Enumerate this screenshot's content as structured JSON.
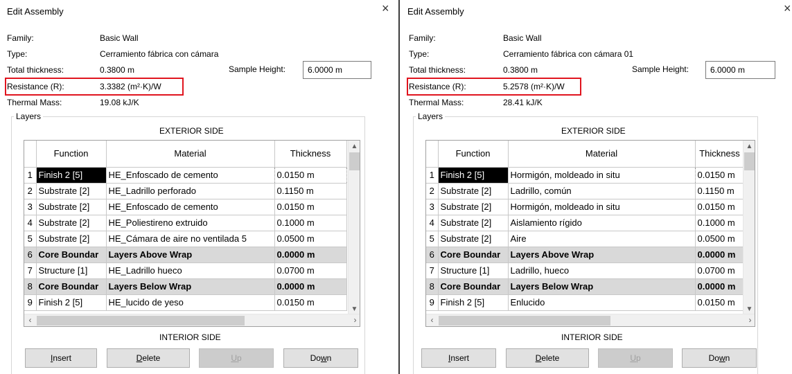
{
  "dialogs": [
    {
      "title": "Edit Assembly",
      "close_symbol": "×",
      "properties": {
        "family_label": "Family:",
        "family_value": "Basic Wall",
        "type_label": "Type:",
        "type_value": "Cerramiento fábrica con cámara",
        "thickness_label": "Total thickness:",
        "thickness_value": "0.3800 m",
        "resistance_label": "Resistance (R):",
        "resistance_value": "3.3382 (m²·K)/W",
        "mass_label": "Thermal Mass:",
        "mass_value": "19.08 kJ/K"
      },
      "sample_height_label": "Sample Height:",
      "sample_height_value": "6.0000 m",
      "layers_label": "Layers",
      "exterior_label": "EXTERIOR SIDE",
      "interior_label": "INTERIOR SIDE",
      "columns": [
        "Function",
        "Material",
        "Thickness"
      ],
      "rows": [
        {
          "num": "1",
          "function": "Finish 2 [5]",
          "material": "HE_Enfoscado de cemento",
          "thickness": "0.0150 m"
        },
        {
          "num": "2",
          "function": "Substrate [2]",
          "material": "HE_Ladrillo perforado",
          "thickness": "0.1150 m"
        },
        {
          "num": "3",
          "function": "Substrate [2]",
          "material": "HE_Enfoscado de cemento",
          "thickness": "0.0150 m"
        },
        {
          "num": "4",
          "function": "Substrate [2]",
          "material": "HE_Poliestireno extruido",
          "thickness": "0.1000 m"
        },
        {
          "num": "5",
          "function": "Substrate [2]",
          "material": "HE_Cámara de aire no ventilada 5",
          "thickness": "0.0500 m"
        },
        {
          "num": "6",
          "function": "Core Boundar",
          "material": "Layers Above Wrap",
          "thickness": "0.0000 m"
        },
        {
          "num": "7",
          "function": "Structure [1]",
          "material": "HE_Ladrillo hueco",
          "thickness": "0.0700 m"
        },
        {
          "num": "8",
          "function": "Core Boundar",
          "material": "Layers Below Wrap",
          "thickness": "0.0000 m"
        },
        {
          "num": "9",
          "function": "Finish 2 [5]",
          "material": "HE_lucido de yeso",
          "thickness": "0.0150 m"
        }
      ],
      "buttons": {
        "insert": {
          "text": "nsert",
          "ul": "I"
        },
        "delete": {
          "text": "elete",
          "ul": "D"
        },
        "up": {
          "text": "p",
          "ul": "U"
        },
        "down": {
          "pre": "Do",
          "ul": "w",
          "text": "n"
        }
      }
    },
    {
      "title": "Edit Assembly",
      "close_symbol": "×",
      "properties": {
        "family_label": "Family:",
        "family_value": "Basic Wall",
        "type_label": "Type:",
        "type_value": "Cerramiento fábrica con cámara 01",
        "thickness_label": "Total thickness:",
        "thickness_value": "0.3800 m",
        "resistance_label": "Resistance (R):",
        "resistance_value": "5.2578 (m²·K)/W",
        "mass_label": "Thermal Mass:",
        "mass_value": "28.41 kJ/K"
      },
      "sample_height_label": "Sample Height:",
      "sample_height_value": "6.0000 m",
      "layers_label": "Layers",
      "exterior_label": "EXTERIOR SIDE",
      "interior_label": "INTERIOR SIDE",
      "columns": [
        "Function",
        "Material",
        "Thickness"
      ],
      "rows": [
        {
          "num": "1",
          "function": "Finish 2 [5]",
          "material": "Hormigón, moldeado in situ",
          "thickness": "0.0150 m"
        },
        {
          "num": "2",
          "function": "Substrate [2]",
          "material": "Ladrillo, común",
          "thickness": "0.1150 m"
        },
        {
          "num": "3",
          "function": "Substrate [2]",
          "material": "Hormigón, moldeado in situ",
          "thickness": "0.0150 m"
        },
        {
          "num": "4",
          "function": "Substrate [2]",
          "material": "Aislamiento rígido",
          "thickness": "0.1000 m"
        },
        {
          "num": "5",
          "function": "Substrate [2]",
          "material": "Aire",
          "thickness": "0.0500 m"
        },
        {
          "num": "6",
          "function": "Core Boundar",
          "material": "Layers Above Wrap",
          "thickness": "0.0000 m"
        },
        {
          "num": "7",
          "function": "Structure [1]",
          "material": "Ladrillo, hueco",
          "thickness": "0.0700 m"
        },
        {
          "num": "8",
          "function": "Core Boundar",
          "material": "Layers Below Wrap",
          "thickness": "0.0000 m"
        },
        {
          "num": "9",
          "function": "Finish 2 [5]",
          "material": "Enlucido",
          "thickness": "0.0150 m"
        }
      ],
      "buttons": {
        "insert": {
          "text": "nsert",
          "ul": "I"
        },
        "delete": {
          "text": "elete",
          "ul": "D"
        },
        "up": {
          "text": "p",
          "ul": "U"
        },
        "down": {
          "pre": "Do",
          "ul": "w",
          "text": "n"
        }
      }
    }
  ],
  "colors": {
    "highlight_box": "#e0141e",
    "core_row": "#d9d9d9",
    "selected_cell": "#000000",
    "disabled_button": "#cccccc"
  }
}
